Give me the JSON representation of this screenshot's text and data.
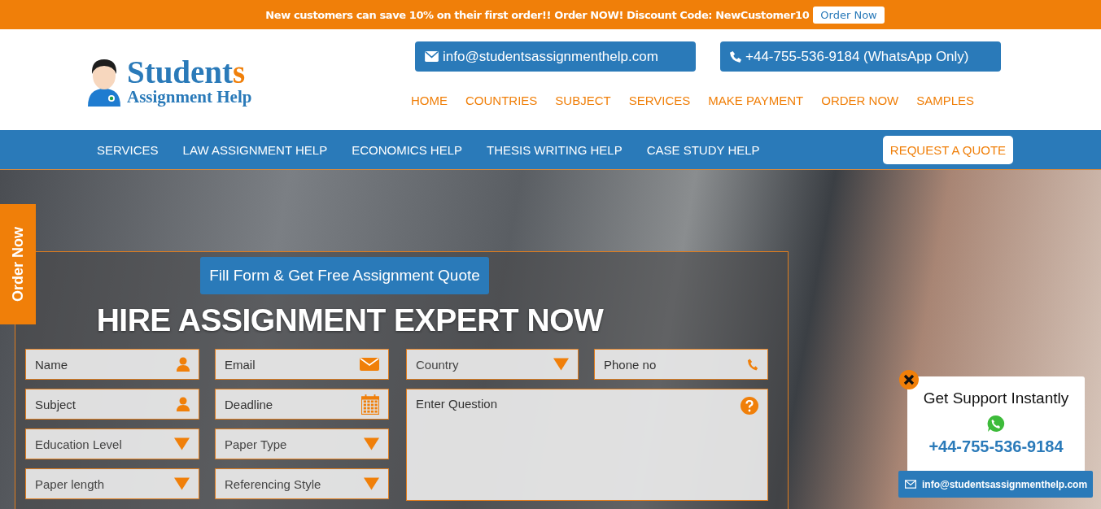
{
  "promo_bar": {
    "text": "New customers can save 10% on their first order!! Order NOW! Discount Code: NewCustomer10",
    "button": "Order Now"
  },
  "logo": {
    "title_main": "Student",
    "title_accent": "s",
    "subtitle": "Assignment Help"
  },
  "contacts": [
    {
      "kind": "email",
      "label": "info@studentsassignmenthelp.com"
    },
    {
      "kind": "phone",
      "label": "+44-755-536-9184 (WhatsApp Only)"
    }
  ],
  "main_menu": [
    "HOME",
    "COUNTRIES",
    "SUBJECT",
    "SERVICES",
    "MAKE PAYMENT",
    "ORDER NOW",
    "SAMPLES"
  ],
  "nav_bar": {
    "items": [
      "SERVICES",
      "LAW ASSIGNMENT HELP",
      "ECONOMICS HELP",
      "THESIS WRITING HELP",
      "CASE STUDY HELP"
    ],
    "button": "REQUEST A QUOTE"
  },
  "side_tab": "Order Now",
  "quote_form": {
    "badge": "Fill Form & Get Free Assignment Quote",
    "heading": "HIRE ASSIGNMENT EXPERT NOW",
    "fields": [
      {
        "kind": "person",
        "placeholder": "Name"
      },
      {
        "kind": "email",
        "placeholder": "Email"
      },
      {
        "kind": "dropdown",
        "placeholder": "Country"
      },
      {
        "kind": "phone",
        "placeholder": "Phone no"
      },
      {
        "kind": "person",
        "placeholder": "Subject"
      },
      {
        "kind": "date",
        "placeholder": "Deadline"
      },
      {
        "kind": "question",
        "placeholder": "Enter Question"
      },
      {
        "kind": "dropdown",
        "placeholder": "Education Level"
      },
      {
        "kind": "dropdown",
        "placeholder": "Paper Type"
      },
      {
        "kind": "dropdown",
        "placeholder": "Paper length"
      },
      {
        "kind": "dropdown",
        "placeholder": "Referencing Style"
      }
    ]
  },
  "support_widget": {
    "title": "Get Support Instantly",
    "phone": "+44-755-536-9184",
    "email": "info@studentsassignmenthelp.com"
  }
}
